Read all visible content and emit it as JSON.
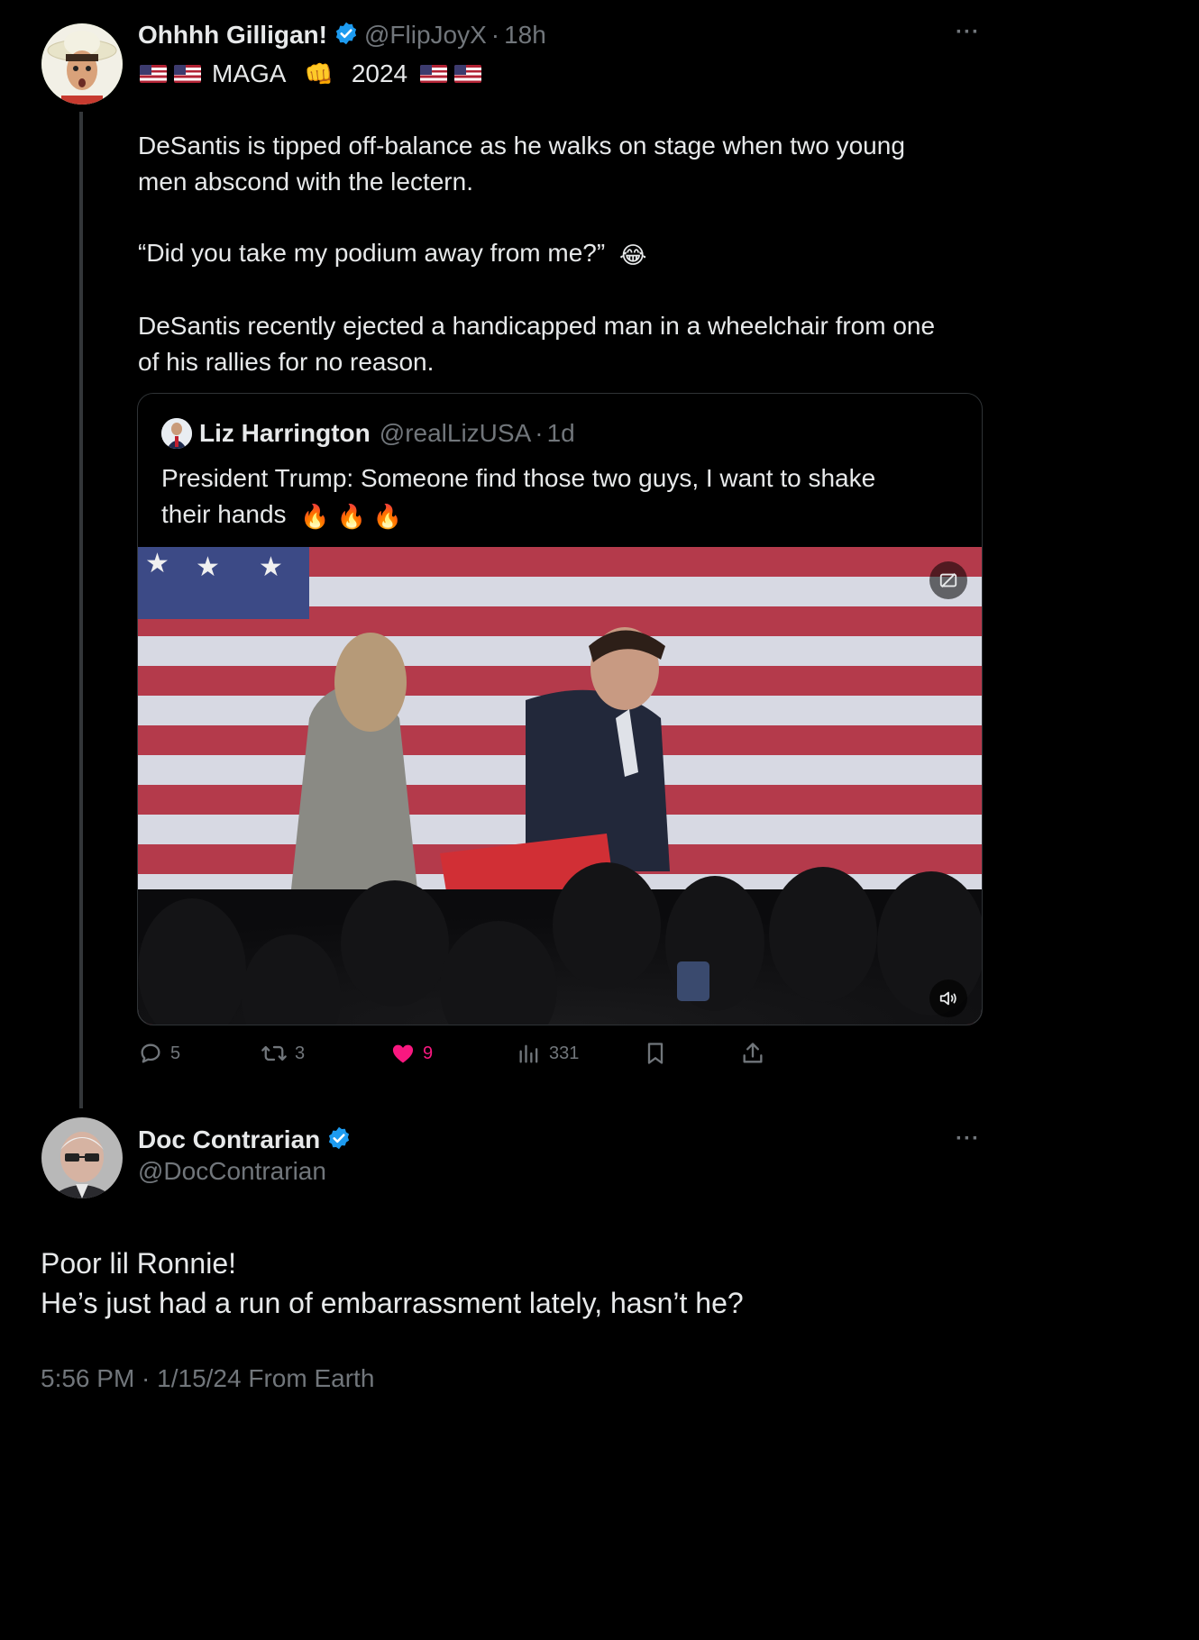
{
  "tweet": {
    "display_name": "Ohhhh Gilligan!",
    "handle": "@FlipJoyX",
    "time": "18h",
    "bio_line": {
      "before": "MAGA",
      "after": "2024"
    },
    "text_line1": "DeSantis is tipped off-balance as he walks on stage when two young",
    "text_line2": "men abscond with the lectern.",
    "quote_text": "“Did you take my podium away from me?”",
    "text_line3": "DeSantis recently ejected a handicapped man in a wheelchair from one",
    "text_line4": "of his rallies for no reason.",
    "emoji_laugh": "😂",
    "emoji_fist": "👊"
  },
  "quoted": {
    "display_name": "Liz Harrington",
    "handle": "@realLizUSA",
    "time": "1d",
    "text_line1": "President Trump: Someone find those two guys, I want to shake",
    "text_line2": "their hands",
    "emoji_fire": "🔥"
  },
  "actions": {
    "replies": "5",
    "reposts": "3",
    "likes": "9",
    "views": "331"
  },
  "reply": {
    "display_name": "Doc Contrarian",
    "handle": "@DocContrarian",
    "line1": "Poor lil Ronnie!",
    "line2": "He’s just had a run of embarrassment lately, hasn’t he?",
    "timestamp": "5:56 PM · 1/15/24 From Earth"
  },
  "colors": {
    "background": "#000000",
    "text": "#e7e9ea",
    "muted": "#71767b",
    "verified": "#1d9bf0",
    "like": "#f91880"
  },
  "icons": [
    "more-icon",
    "verified-icon",
    "reply-icon",
    "repost-icon",
    "like-icon",
    "views-icon",
    "bookmark-icon",
    "share-icon",
    "media-settings-icon",
    "volume-icon"
  ]
}
